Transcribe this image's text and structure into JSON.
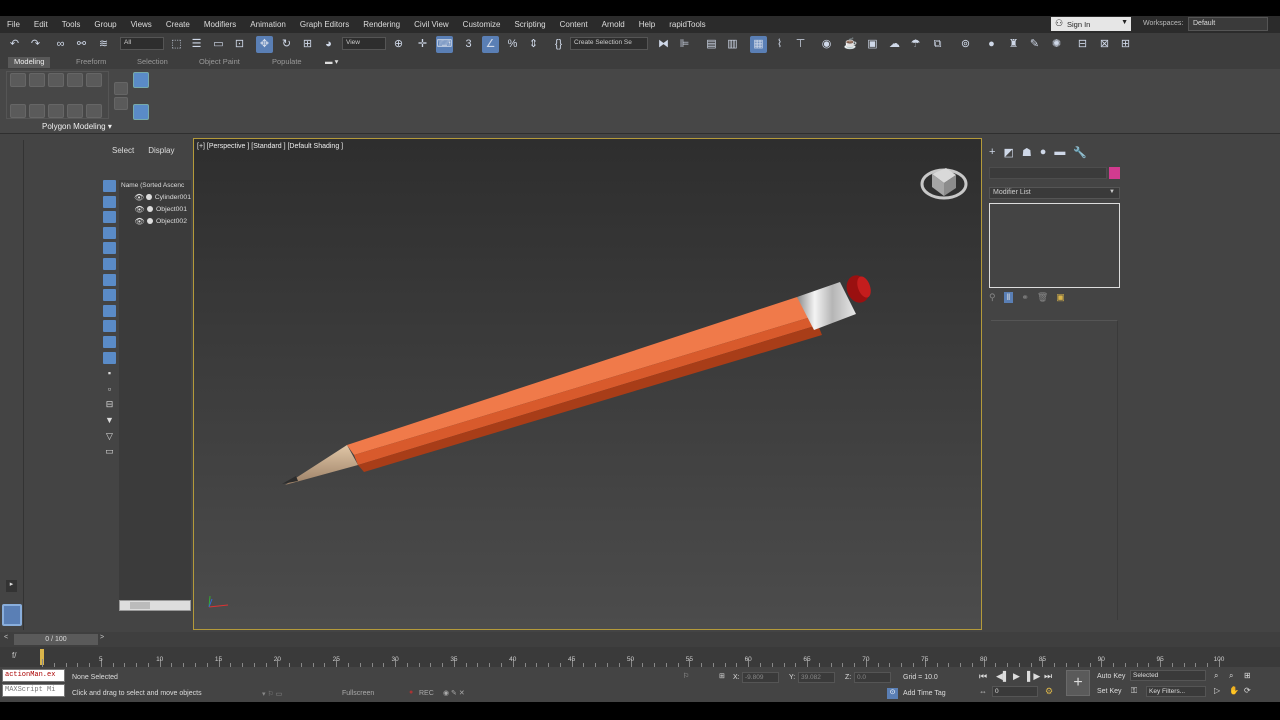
{
  "menu": [
    "File",
    "Edit",
    "Tools",
    "Group",
    "Views",
    "Create",
    "Modifiers",
    "Animation",
    "Graph Editors",
    "Rendering",
    "Civil View",
    "Customize",
    "Scripting",
    "Content",
    "Arnold",
    "Help",
    "rapidTools"
  ],
  "account": {
    "sign_in": "Sign In",
    "workspaces_label": "Workspaces:",
    "workspace_value": "Default"
  },
  "toolbar": {
    "filter": "All",
    "ref_coord": "View",
    "selection_set": "Create Selection Se"
  },
  "ribbon": {
    "tabs": [
      "Modeling",
      "Freeform",
      "Selection",
      "Object Paint",
      "Populate"
    ],
    "active_tab": "Modeling",
    "panel_title": "Polygon Modeling ▾"
  },
  "explorer": {
    "tabs": [
      "Select",
      "Display"
    ],
    "column_header": "Name (Sorted Ascenc",
    "items": [
      "Cylinder001",
      "Object001",
      "Object002"
    ]
  },
  "viewport": {
    "label": "[+] [Perspective ] [Standard ] [Default Shading ]"
  },
  "command_panel": {
    "modifier_list": "Modifier List",
    "object_color": "#d23b8f"
  },
  "timeline": {
    "range": "0 / 100",
    "ticks": [
      "0",
      "5",
      "10",
      "15",
      "20",
      "25",
      "30",
      "35",
      "40",
      "45",
      "50",
      "55",
      "60",
      "65",
      "70",
      "75",
      "80",
      "85",
      "90",
      "95",
      "100"
    ]
  },
  "status": {
    "script_line1": "actionMan.ex",
    "script_line2": "MAXScript Mi",
    "selection": "None Selected",
    "prompt": "Click and drag to select and move objects",
    "fullscreen": "Fullscreen",
    "rec": "REC",
    "x_label": "X:",
    "x_value": "-9.809",
    "y_label": "Y:",
    "y_value": "39.082",
    "z_label": "Z:",
    "z_value": "0.0",
    "grid": "Grid = 10.0",
    "add_time_tag": "Add Time Tag",
    "auto_key": "Auto Key",
    "set_key": "Set Key",
    "key_mode": "Selected",
    "key_filters": "Key Filters...",
    "frame": "0"
  },
  "colors": {
    "viewport_border": "#b49a3a",
    "accent": "#5a7fb5",
    "pencil_body": "#d85a2c",
    "eraser": "#9a1010"
  }
}
